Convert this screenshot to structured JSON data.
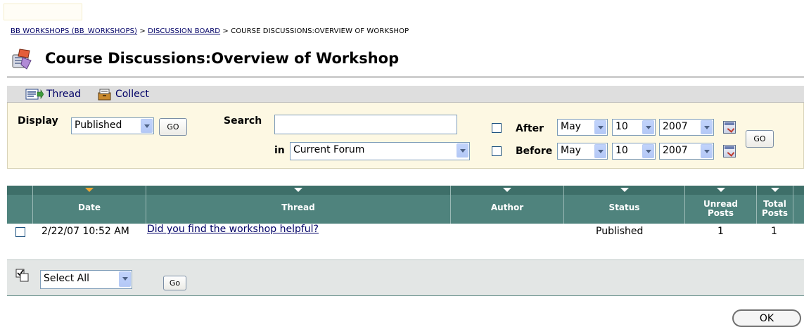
{
  "breadcrumb": {
    "item1": "BB WORKSHOPS (BB_WORKSHOPS)",
    "sep": ">",
    "item2": "DISCUSSION BOARD",
    "current": "COURSE DISCUSSIONS:OVERVIEW OF WORKSHOP"
  },
  "page": {
    "title": "Course Discussions:Overview of Workshop"
  },
  "actions": {
    "thread": "Thread",
    "collect": "Collect"
  },
  "filters": {
    "display_label": "Display",
    "display_value": "Published",
    "go_label": "GO",
    "search_label": "Search",
    "search_value": "",
    "in_label": "in",
    "in_value": "Current Forum",
    "after_label": "After",
    "before_label": "Before",
    "after": {
      "month": "May",
      "day": "10",
      "year": "2007"
    },
    "before": {
      "month": "May",
      "day": "10",
      "year": "2007"
    },
    "date_go_label": "GO"
  },
  "table": {
    "columns": {
      "date": "Date",
      "thread": "Thread",
      "author": "Author",
      "status": "Status",
      "unread_l1": "Unread",
      "unread_l2": "Posts",
      "total_l1": "Total",
      "total_l2": "Posts"
    },
    "rows": [
      {
        "date": "2/22/07 10:52 AM",
        "thread": "Did you find the workshop helpful?",
        "author": "",
        "status": "Published",
        "unread": "1",
        "total": "1"
      }
    ]
  },
  "bulk": {
    "select_value": "Select All",
    "go_label": "Go"
  },
  "footer": {
    "ok_label": "OK"
  },
  "icons": {
    "title": "discussion-board-icon",
    "thread": "new-thread-icon",
    "collect": "collect-icon",
    "calendar": "calendar-icon"
  },
  "colors": {
    "header_bg": "#4f837d",
    "filter_bg": "#fdf8e3",
    "link": "#000066"
  }
}
